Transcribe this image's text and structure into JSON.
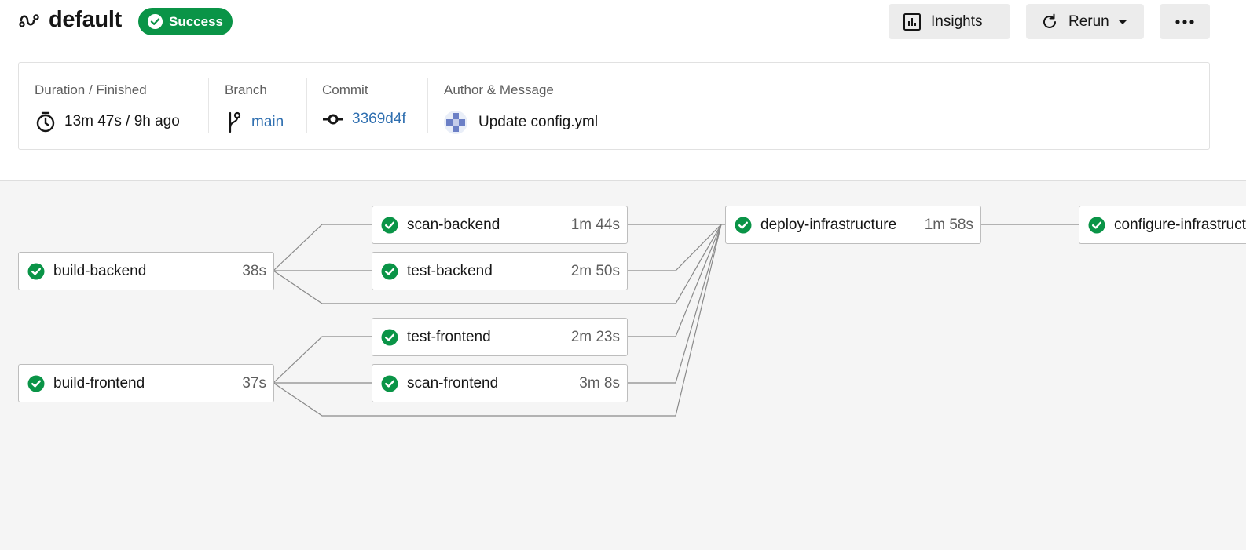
{
  "workflow": {
    "name": "default",
    "status": "Success",
    "status_color": "#0a9447"
  },
  "actions": {
    "insights": "Insights",
    "rerun": "Rerun"
  },
  "summary": {
    "duration_label": "Duration / Finished",
    "duration_value": "13m 47s / 9h ago",
    "branch_label": "Branch",
    "branch_value": "main",
    "commit_label": "Commit",
    "commit_value": "3369d4f",
    "author_label": "Author & Message",
    "message": "Update config.yml"
  },
  "jobs": [
    {
      "name": "build-backend",
      "duration": "38s",
      "status": "success"
    },
    {
      "name": "build-frontend",
      "duration": "37s",
      "status": "success"
    },
    {
      "name": "scan-backend",
      "duration": "1m 44s",
      "status": "success"
    },
    {
      "name": "test-backend",
      "duration": "2m 50s",
      "status": "success"
    },
    {
      "name": "test-frontend",
      "duration": "2m 23s",
      "status": "success"
    },
    {
      "name": "scan-frontend",
      "duration": "3m 8s",
      "status": "success"
    },
    {
      "name": "deploy-infrastructure",
      "duration": "1m 58s",
      "status": "success"
    },
    {
      "name": "configure-infrastructure",
      "duration": "",
      "status": "success"
    }
  ],
  "icons": {
    "workflow": "workflow-icon",
    "status": "check-circle-icon",
    "insights": "bar-chart-icon",
    "rerun": "refresh-icon",
    "more": "more-dots-icon",
    "duration": "timer-icon",
    "branch": "branch-icon",
    "commit": "commit-icon"
  }
}
